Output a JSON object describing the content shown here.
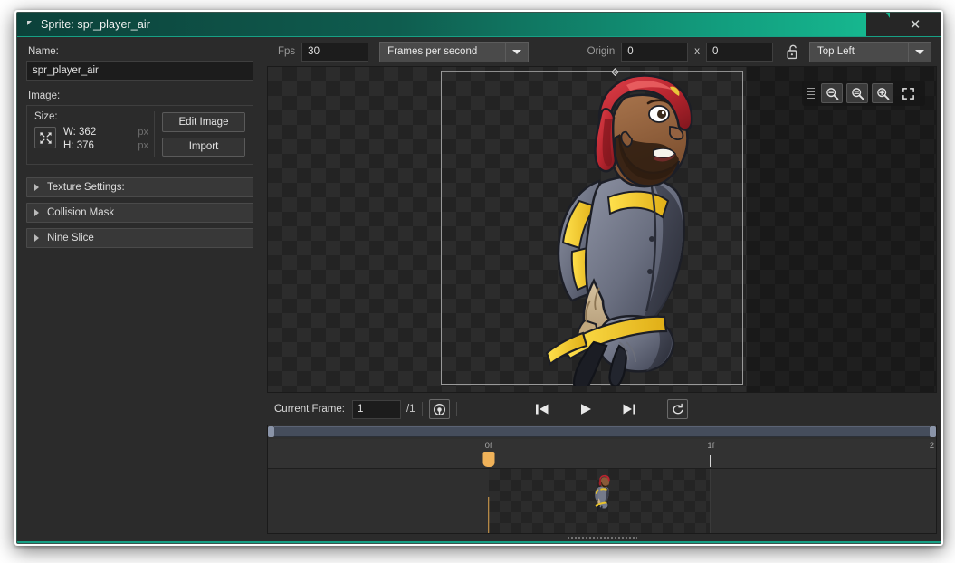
{
  "window": {
    "title": "Sprite: spr_player_air",
    "collapse_icon": "triangle-collapse-icon",
    "close_label": "✕"
  },
  "sidebar": {
    "name_label": "Name:",
    "name_value": "spr_player_air",
    "image_label": "Image:",
    "size_label": "Size:",
    "width_text": "W: 362",
    "height_text": "H: 376",
    "unit_w": "px",
    "unit_h": "px",
    "resize_icon": "resize-arrows-icon",
    "edit_image_label": "Edit Image",
    "import_label": "Import",
    "accordions": [
      {
        "label": "Texture Settings:",
        "icon": "chevron-right-icon"
      },
      {
        "label": "Collision Mask",
        "icon": "chevron-right-icon"
      },
      {
        "label": "Nine Slice",
        "icon": "chevron-right-icon"
      }
    ]
  },
  "toolbar": {
    "fps_label": "Fps",
    "fps_value": "30",
    "playback_mode": "Frames per second",
    "playback_dropdown_icon": "chevron-down-icon",
    "origin_label": "Origin",
    "origin_x": "0",
    "origin_separator": "x",
    "origin_y": "0",
    "lock_icon": "unlocked-padlock-icon",
    "origin_preset": "Top Left",
    "origin_dropdown_icon": "chevron-down-icon"
  },
  "canvas": {
    "zoom_tools": [
      {
        "name": "zoom-out-icon",
        "glyph": "−"
      },
      {
        "name": "zoom-reset-icon",
        "glyph": "="
      },
      {
        "name": "zoom-in-icon",
        "glyph": "+"
      },
      {
        "name": "fit-to-screen-icon",
        "glyph": ""
      }
    ],
    "grip_icon": "drag-grip-icon",
    "origin_handle_icon": "origin-diamond-icon",
    "sprite_alt": "firefighter-character-sprite"
  },
  "playback": {
    "current_frame_label": "Current Frame:",
    "current_frame_value": "1",
    "total_frames": "/1",
    "frame_origin_icon": "frame-origin-icon",
    "prev_frame_icon": "skip-previous-icon",
    "play_icon": "play-icon",
    "next_frame_icon": "skip-next-icon",
    "loop_icon": "loop-icon"
  },
  "timeline": {
    "ticks": [
      {
        "label": "0f",
        "pos_pct": 33.0
      },
      {
        "label": "1f",
        "pos_pct": 66.3
      },
      {
        "label": "2",
        "pos_pct": 99.6
      }
    ],
    "playhead_pos_pct": 33.0,
    "frames": [
      {
        "start_pct": 33.0,
        "end_pct": 66.3
      }
    ],
    "scroll_left_icon": "scroll-handle-left",
    "scroll_right_icon": "scroll-handle-right",
    "resize_grip_icon": "resize-grip-icon"
  },
  "colors": {
    "accent": "#16b78f",
    "panel_bg": "#2b2b2b",
    "input_bg": "#1c1c1c",
    "playhead": "#f0b259",
    "scrollbar": "#8a94a8"
  }
}
